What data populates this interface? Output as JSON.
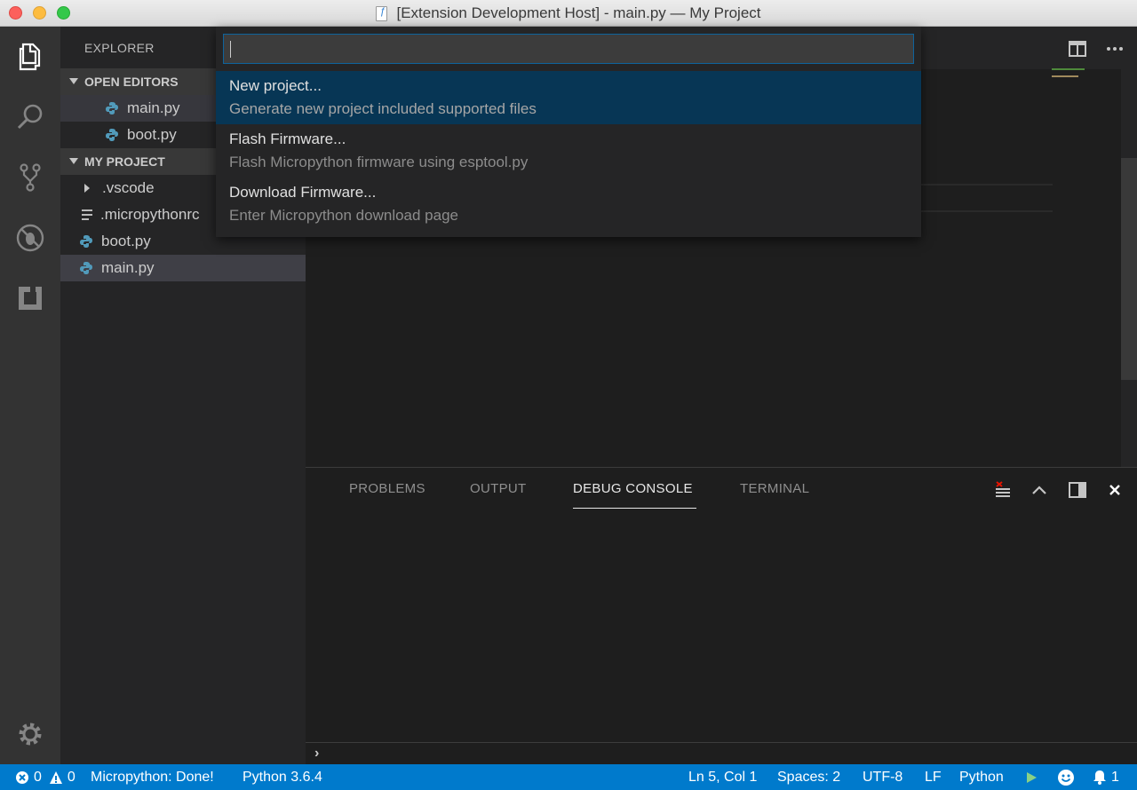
{
  "window": {
    "title": "[Extension Development Host] - main.py — My Project"
  },
  "activity_bar": {
    "items": [
      {
        "name": "explorer-icon"
      },
      {
        "name": "search-icon"
      },
      {
        "name": "source-control-icon"
      },
      {
        "name": "debug-icon"
      },
      {
        "name": "extensions-icon"
      },
      {
        "name": "settings-gear-icon"
      }
    ]
  },
  "sidebar": {
    "title": "EXPLORER",
    "open_editors_header": "OPEN EDITORS",
    "open_editors": [
      {
        "label": "main.py",
        "selected": true
      },
      {
        "label": "boot.py",
        "selected": false
      }
    ],
    "project_header": "MY PROJECT",
    "files": [
      {
        "label": ".vscode",
        "kind": "folder"
      },
      {
        "label": ".micropythonrc",
        "kind": "text"
      },
      {
        "label": "boot.py",
        "kind": "python"
      },
      {
        "label": "main.py",
        "kind": "python",
        "selected": true
      }
    ]
  },
  "quick_pick": {
    "input_value": "",
    "items": [
      {
        "label": "New project...",
        "description": "Generate new project included supported files",
        "selected": true
      },
      {
        "label": "Flash Firmware...",
        "description": "Flash Micropython firmware using esptool.py",
        "selected": false
      },
      {
        "label": "Download Firmware...",
        "description": "Enter Micropython download page",
        "selected": false
      }
    ]
  },
  "panel": {
    "tabs": [
      {
        "label": "PROBLEMS",
        "active": false
      },
      {
        "label": "OUTPUT",
        "active": false
      },
      {
        "label": "DEBUG CONSOLE",
        "active": true
      },
      {
        "label": "TERMINAL",
        "active": false
      }
    ],
    "prompt": "›"
  },
  "status_bar": {
    "errors": "0",
    "warnings": "0",
    "micropython_status": "Micropython: Done!",
    "python_version": "Python 3.6.4",
    "cursor_position": "Ln 5, Col 1",
    "indentation": "Spaces: 2",
    "encoding": "UTF-8",
    "line_ending": "LF",
    "language": "Python",
    "notifications": "1"
  },
  "colors": {
    "status_bar": "#007acc",
    "activity_bar": "#333333",
    "sidebar": "#252526",
    "editor": "#1e1e1e",
    "selection": "#073655",
    "python_icon": "#519aba"
  }
}
